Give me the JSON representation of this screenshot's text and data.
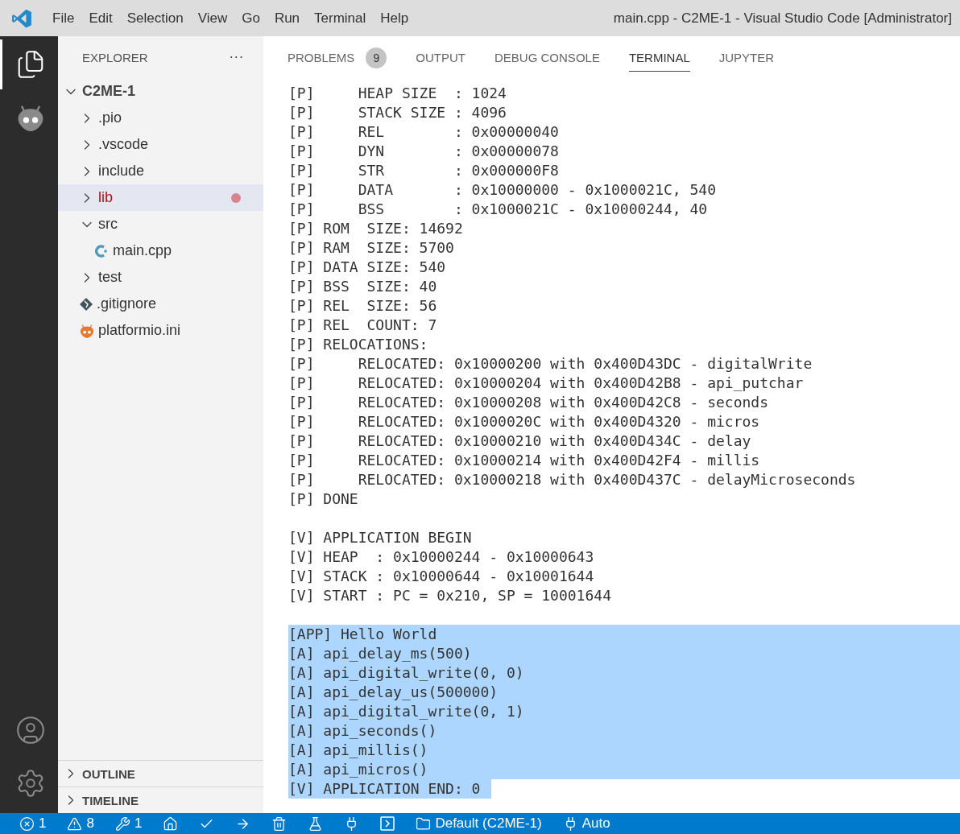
{
  "window": {
    "title": "main.cpp - C2ME-1 - Visual Studio Code [Administrator]"
  },
  "menu": [
    "File",
    "Edit",
    "Selection",
    "View",
    "Go",
    "Run",
    "Terminal",
    "Help"
  ],
  "activity_bar": [
    {
      "kind": "explorer",
      "selected": true
    },
    {
      "kind": "platformio",
      "selected": false
    }
  ],
  "sidebar": {
    "title": "EXPLORER",
    "more": "···",
    "tree": [
      {
        "label": "C2ME-1",
        "kind": "root",
        "expanded": true,
        "selected": false,
        "problem": false,
        "children": [
          {
            "label": ".pio",
            "kind": "folder",
            "expanded": false,
            "selected": false,
            "problem": false
          },
          {
            "label": ".vscode",
            "kind": "folder",
            "expanded": false,
            "selected": false,
            "problem": false
          },
          {
            "label": "include",
            "kind": "folder",
            "expanded": false,
            "selected": false,
            "problem": false
          },
          {
            "label": "lib",
            "kind": "folder",
            "expanded": false,
            "selected": true,
            "problem": true
          },
          {
            "label": "src",
            "kind": "folder",
            "expanded": true,
            "selected": false,
            "problem": false,
            "children": [
              {
                "label": "main.cpp",
                "kind": "cpp",
                "selected": false,
                "problem": false
              }
            ]
          },
          {
            "label": "test",
            "kind": "folder",
            "expanded": false,
            "selected": false,
            "problem": false
          },
          {
            "label": ".gitignore",
            "kind": "git",
            "selected": false,
            "problem": false
          },
          {
            "label": "platformio.ini",
            "kind": "platformio",
            "selected": false,
            "problem": false
          }
        ]
      }
    ],
    "sections": [
      {
        "label": "OUTLINE",
        "expanded": false
      },
      {
        "label": "TIMELINE",
        "expanded": false
      }
    ]
  },
  "panel": {
    "tabs": [
      {
        "label": "PROBLEMS",
        "badge": "9",
        "selected": false
      },
      {
        "label": "OUTPUT",
        "selected": false
      },
      {
        "label": "DEBUG CONSOLE",
        "selected": false
      },
      {
        "label": "TERMINAL",
        "selected": true
      },
      {
        "label": "JUPYTER",
        "selected": false
      }
    ],
    "terminal": [
      {
        "kind": "text",
        "text": "[P]     HEAP SIZE  : 1024",
        "selected": false
      },
      {
        "kind": "text",
        "text": "[P]     STACK SIZE : 4096",
        "selected": false
      },
      {
        "kind": "text",
        "text": "[P]     REL        : 0x00000040",
        "selected": false
      },
      {
        "kind": "text",
        "text": "[P]     DYN        : 0x00000078",
        "selected": false
      },
      {
        "kind": "text",
        "text": "[P]     STR        : 0x000000F8",
        "selected": false
      },
      {
        "kind": "text",
        "text": "[P]     DATA       : 0x10000000 - 0x1000021C, 540",
        "selected": false
      },
      {
        "kind": "text",
        "text": "[P]     BSS        : 0x1000021C - 0x10000244, 40",
        "selected": false
      },
      {
        "kind": "text",
        "text": "[P] ROM  SIZE: 14692",
        "selected": false
      },
      {
        "kind": "text",
        "text": "[P] RAM  SIZE: 5700",
        "selected": false
      },
      {
        "kind": "text",
        "text": "[P] DATA SIZE: 540",
        "selected": false
      },
      {
        "kind": "text",
        "text": "[P] BSS  SIZE: 40",
        "selected": false
      },
      {
        "kind": "text",
        "text": "[P] REL  SIZE: 56",
        "selected": false
      },
      {
        "kind": "text",
        "text": "[P] REL  COUNT: 7",
        "selected": false
      },
      {
        "kind": "text",
        "text": "[P] RELOCATIONS:",
        "selected": false
      },
      {
        "kind": "text",
        "text": "[P]     RELOCATED: 0x10000200 with 0x400D43DC - digitalWrite",
        "selected": false
      },
      {
        "kind": "text",
        "text": "[P]     RELOCATED: 0x10000204 with 0x400D42B8 - api_putchar",
        "selected": false
      },
      {
        "kind": "text",
        "text": "[P]     RELOCATED: 0x10000208 with 0x400D42C8 - seconds",
        "selected": false
      },
      {
        "kind": "text",
        "text": "[P]     RELOCATED: 0x1000020C with 0x400D4320 - micros",
        "selected": false
      },
      {
        "kind": "text",
        "text": "[P]     RELOCATED: 0x10000210 with 0x400D434C - delay",
        "selected": false
      },
      {
        "kind": "text",
        "text": "[P]     RELOCATED: 0x10000214 with 0x400D42F4 - millis",
        "selected": false
      },
      {
        "kind": "text",
        "text": "[P]     RELOCATED: 0x10000218 with 0x400D437C - delayMicroseconds",
        "selected": false
      },
      {
        "kind": "text",
        "text": "[P] DONE",
        "selected": false
      },
      {
        "kind": "blank",
        "selected": false
      },
      {
        "kind": "text",
        "text": "[V] APPLICATION BEGIN",
        "selected": false
      },
      {
        "kind": "text",
        "text": "[V] HEAP  : 0x10000244 - 0x10000643",
        "selected": false
      },
      {
        "kind": "text",
        "text": "[V] STACK : 0x10000644 - 0x10001644",
        "selected": false
      },
      {
        "kind": "text",
        "text": "[V] START : PC = 0x210, SP = 10001644",
        "selected": false
      },
      {
        "kind": "blank",
        "selected": false
      },
      {
        "kind": "text",
        "text": "[APP] Hello World",
        "selected": true
      },
      {
        "kind": "text",
        "text": "[A] api_delay_ms(500)",
        "selected": true
      },
      {
        "kind": "text",
        "text": "[A] api_digital_write(0, 0)",
        "selected": true
      },
      {
        "kind": "text",
        "text": "[A] api_delay_us(500000)",
        "selected": true
      },
      {
        "kind": "text",
        "text": "[A] api_digital_write(0, 1)",
        "selected": true
      },
      {
        "kind": "text",
        "text": "[A] api_seconds()",
        "selected": true
      },
      {
        "kind": "text",
        "text": "[A] api_millis()",
        "selected": true
      },
      {
        "kind": "text",
        "text": "[A] api_micros()",
        "selected": true
      },
      {
        "kind": "end",
        "text": "[V] APPLICATION END: 0",
        "selected": true
      }
    ]
  },
  "status_bar": [
    {
      "kind": "errors",
      "text": "1"
    },
    {
      "kind": "warnings",
      "text": "8"
    },
    {
      "kind": "tools",
      "text": "1"
    },
    {
      "kind": "home"
    },
    {
      "kind": "check"
    },
    {
      "kind": "arrow"
    },
    {
      "kind": "trash"
    },
    {
      "kind": "flask"
    },
    {
      "kind": "plug"
    },
    {
      "kind": "terminal"
    },
    {
      "kind": "folder",
      "text": "Default (C2ME-1)"
    },
    {
      "kind": "plug",
      "text": "Auto"
    }
  ]
}
